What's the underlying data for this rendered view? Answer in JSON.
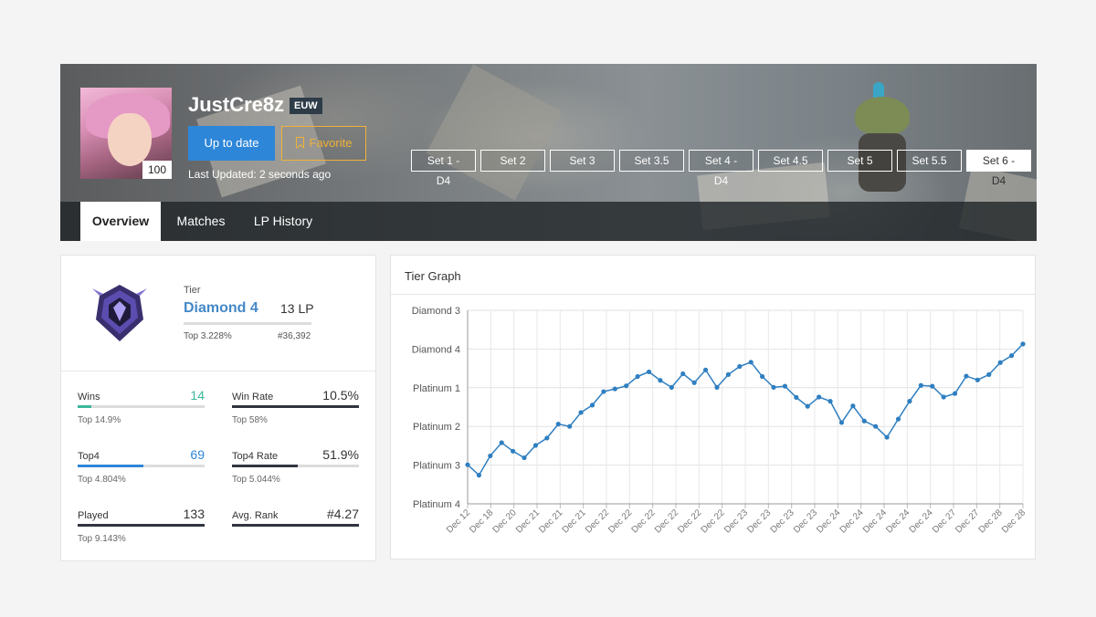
{
  "profile": {
    "summoner_name": "JustCre8z",
    "region": "EUW",
    "level": "100",
    "update_label": "Up to date",
    "favorite_label": "Favorite",
    "last_updated": "Last Updated: 2 seconds ago"
  },
  "set_tabs": [
    {
      "label": "Set 1 - D4",
      "active": false
    },
    {
      "label": "Set 2",
      "active": false
    },
    {
      "label": "Set 3",
      "active": false
    },
    {
      "label": "Set 3.5",
      "active": false
    },
    {
      "label": "Set 4 - D4",
      "active": false
    },
    {
      "label": "Set 4.5",
      "active": false
    },
    {
      "label": "Set 5",
      "active": false
    },
    {
      "label": "Set 5.5",
      "active": false
    },
    {
      "label": "Set 6 - D4",
      "active": true
    }
  ],
  "nav_tabs": [
    {
      "label": "Overview",
      "active": true
    },
    {
      "label": "Matches",
      "active": false
    },
    {
      "label": "LP History",
      "active": false
    }
  ],
  "rank": {
    "tier_label": "Tier",
    "tier_name": "Diamond 4",
    "lp": "13 LP",
    "top_percent": "Top 3.228%",
    "ladder_rank": "#36,392"
  },
  "stats": {
    "wins": {
      "label": "Wins",
      "value": "14",
      "sub": "Top 14.9%",
      "fill_fraction": 0.105,
      "color": "#3ab89a"
    },
    "win_rate": {
      "label": "Win Rate",
      "value": "10.5%",
      "sub": "Top 58%",
      "fill_fraction": 1.0,
      "color": "#2f3540"
    },
    "top4": {
      "label": "Top4",
      "value": "69",
      "sub": "Top 4.804%",
      "fill_fraction": 0.519,
      "color": "#2e86d8"
    },
    "top4_rate": {
      "label": "Top4 Rate",
      "value": "51.9%",
      "sub": "Top 5.044%",
      "fill_fraction": 0.519,
      "color": "#2f3540"
    },
    "played": {
      "label": "Played",
      "value": "133",
      "sub": "Top 9.143%",
      "fill_fraction": 1.0,
      "color": "#2f3540"
    },
    "avg_rank": {
      "label": "Avg. Rank",
      "value": "#4.27",
      "sub": "",
      "fill_fraction": 1.0,
      "color": "#2f3540"
    }
  },
  "graph": {
    "title": "Tier Graph"
  },
  "chart_data": {
    "type": "line",
    "title": "Tier Graph",
    "y_tick_labels": [
      "Diamond 3",
      "Diamond 4",
      "Platinum 1",
      "Platinum 2",
      "Platinum 3",
      "Platinum 4"
    ],
    "y_scale_note": "each tier division = 100 LP; 0 = Platinum 4 0LP",
    "ylim": [
      0,
      500
    ],
    "x_tick_labels": [
      "Dec 12",
      "Dec 18",
      "Dec 20",
      "Dec 21",
      "Dec 21",
      "Dec 21",
      "Dec 22",
      "Dec 22",
      "Dec 22",
      "Dec 22",
      "Dec 22",
      "Dec 22",
      "Dec 23",
      "Dec 23",
      "Dec 23",
      "Dec 23",
      "Dec 24",
      "Dec 24",
      "Dec 24",
      "Dec 24",
      "Dec 24",
      "Dec 27",
      "Dec 27",
      "Dec 28",
      "Dec 28"
    ],
    "grid": true,
    "series": [
      {
        "color": "#2f7fc1",
        "values": [
          101,
          74,
          124,
          158,
          136,
          119,
          151,
          170,
          206,
          200,
          236,
          255,
          290,
          297,
          305,
          329,
          341,
          319,
          301,
          336,
          313,
          346,
          301,
          334,
          355,
          366,
          329,
          301,
          304,
          275,
          252,
          276,
          265,
          210,
          253,
          214,
          200,
          172,
          219,
          265,
          306,
          304,
          276,
          285,
          330,
          320,
          334,
          365,
          383,
          413
        ]
      }
    ]
  }
}
